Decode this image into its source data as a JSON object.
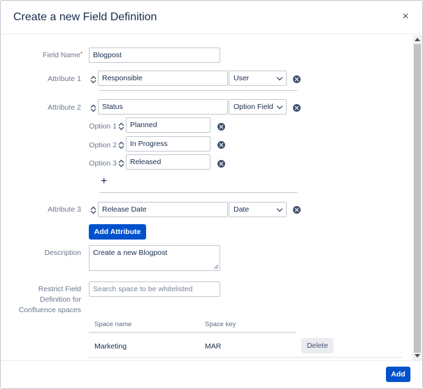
{
  "dialog": {
    "title": "Create a new Field Definition",
    "close_symbol": "×"
  },
  "field_name": {
    "label": "Field Name",
    "required_mark": "*",
    "value": "Blogpost"
  },
  "attributes": [
    {
      "label": "Attribute 1",
      "name": "Responsible",
      "type": "User"
    },
    {
      "label": "Attribute 2",
      "name": "Status",
      "type": "Option Field",
      "options": [
        {
          "label": "Option 1",
          "value": "Planned"
        },
        {
          "label": "Option 2",
          "value": "In Progress"
        },
        {
          "label": "Option 3",
          "value": "Released"
        }
      ],
      "add_option_symbol": "+"
    },
    {
      "label": "Attribute 3",
      "name": "Release Date",
      "type": "Date"
    }
  ],
  "add_attribute_label": "Add Attribute",
  "description": {
    "label": "Description",
    "value": "Create a new Blogpost"
  },
  "restrict": {
    "label_line1": "Restrict Field",
    "label_line2": "Definition for",
    "label_line3": "Confluence spaces",
    "search_placeholder": "Search space to be whitelisted",
    "table": {
      "headers": [
        "Space name",
        "Space key"
      ],
      "rows": [
        {
          "name": "Marketing",
          "key": "MAR",
          "action": "Delete"
        }
      ]
    }
  },
  "footer": {
    "add_label": "Add"
  },
  "icons": {
    "close": "close-icon",
    "sort": "sort-arrows-icon",
    "remove": "remove-circle-icon",
    "add": "plus-icon",
    "chevron": "chevron-down-icon"
  },
  "colors": {
    "primary": "#0052cc",
    "text": "#172b4d",
    "label": "#6b778c",
    "border": "#c1c7d0",
    "required": "#de350b"
  }
}
